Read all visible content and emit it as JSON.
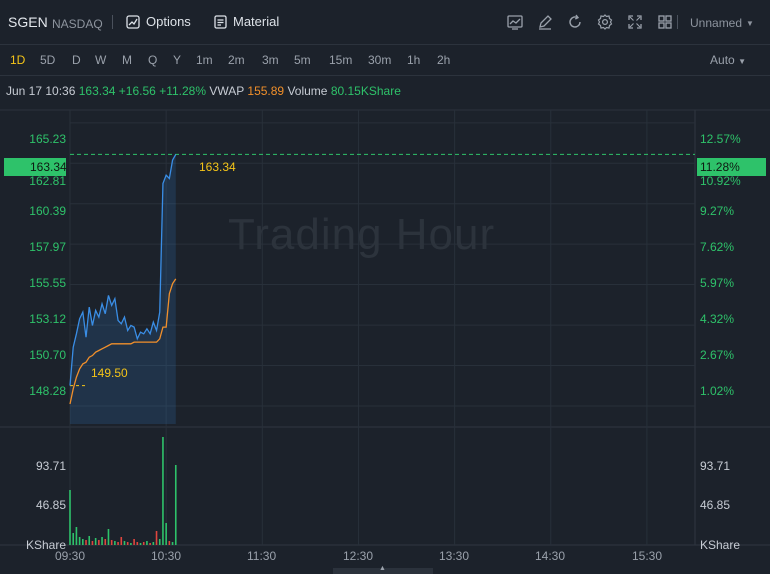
{
  "header": {
    "ticker": "SGEN",
    "exchange": "NASDAQ",
    "options_label": "Options",
    "material_label": "Material",
    "layout_name": "Unnamed",
    "tool_icons": [
      "chart-icon",
      "edit-icon",
      "refresh-icon",
      "settings-icon",
      "fullscreen-icon",
      "grid-icon"
    ]
  },
  "timeframes": [
    "1D",
    "5D",
    "D",
    "W",
    "M",
    "Q",
    "Y",
    "1m",
    "2m",
    "3m",
    "5m",
    "15m",
    "30m",
    "1h",
    "2h"
  ],
  "active_timeframe": "1D",
  "auto_label": "Auto",
  "info": {
    "datetime": "Jun 17 10:36",
    "price": "163.34",
    "change": "+16.56",
    "change_pct": "+11.28%",
    "vwap_label": "VWAP",
    "vwap_value": "155.89",
    "volume_label": "Volume",
    "volume_value": "80.15KShare"
  },
  "watermark": "Trading Hour",
  "price_axis": [
    "165.23",
    "162.81",
    "160.39",
    "157.97",
    "155.55",
    "153.12",
    "150.70",
    "148.28"
  ],
  "pct_axis": [
    "12.57%",
    "10.92%",
    "9.27%",
    "7.62%",
    "5.97%",
    "4.32%",
    "2.67%",
    "1.02%"
  ],
  "current_price_badge": "163.34",
  "current_pct_badge": "11.28%",
  "line_label_current": "163.34",
  "line_label_prevclose": "149.50",
  "volume_axis": [
    "93.71",
    "46.85"
  ],
  "volume_unit": "KShare",
  "time_axis": [
    "09:30",
    "10:30",
    "11:30",
    "12:30",
    "13:30",
    "14:30",
    "15:30"
  ],
  "colors": {
    "up": "#2ec26a",
    "down": "#e0463e",
    "price_line": "#3a8ee6",
    "vwap_line": "#f2902b",
    "accent": "#f5c518"
  },
  "chart_data": {
    "type": "line",
    "series": [
      {
        "name": "",
        "x": [
          "09:30",
          "09:32",
          "09:34",
          "09:36",
          "09:38",
          "09:40",
          "09:42",
          "09:44",
          "09:46",
          "09:48",
          "09:50",
          "09:52",
          "09:54",
          "09:56",
          "09:58",
          "10:00",
          "10:02",
          "10:04",
          "10:06",
          "10:08",
          "10:10",
          "10:12",
          "10:14",
          "10:16",
          "10:18",
          "10:20",
          "10:22",
          "10:24",
          "10:26",
          "10:28",
          "10:30",
          "10:32",
          "10:34",
          "10:36"
        ],
        "values": [
          149.5,
          151.8,
          152.6,
          153.5,
          153.9,
          152.4,
          154.2,
          153.1,
          154.0,
          153.6,
          154.4,
          153.8,
          154.9,
          154.3,
          154.7,
          153.4,
          153.2,
          153.6,
          152.8,
          153.1,
          153.0,
          152.3,
          152.7,
          152.6,
          152.9,
          152.6,
          153.3,
          152.8,
          153.9,
          161.6,
          162.1,
          161.9,
          163.0,
          163.34
        ]
      },
      {
        "name": "VWAP",
        "x": [
          "09:30",
          "09:32",
          "09:34",
          "09:36",
          "09:38",
          "09:40",
          "09:42",
          "09:44",
          "09:46",
          "09:48",
          "09:50",
          "09:52",
          "09:54",
          "09:56",
          "09:58",
          "10:00",
          "10:02",
          "10:04",
          "10:06",
          "10:08",
          "10:10",
          "10:12",
          "10:14",
          "10:16",
          "10:18",
          "10:20",
          "10:22",
          "10:24",
          "10:26",
          "10:28",
          "10:30",
          "10:32",
          "10:34",
          "10:36"
        ],
        "values": [
          148.4,
          149.3,
          150.0,
          150.5,
          150.8,
          150.9,
          151.2,
          151.3,
          151.5,
          151.6,
          151.7,
          151.8,
          151.9,
          152.0,
          152.0,
          152.0,
          152.0,
          152.0,
          152.0,
          152.0,
          152.1,
          152.1,
          152.1,
          152.1,
          152.1,
          152.1,
          152.1,
          152.1,
          152.3,
          153.0,
          153.0,
          155.0,
          155.6,
          155.89
        ]
      }
    ],
    "volume": [
      55,
      12,
      18,
      8,
      6,
      5,
      9,
      4,
      7,
      5,
      8,
      6,
      16,
      5,
      4,
      3,
      8,
      4,
      3,
      2,
      6,
      3,
      2,
      3,
      4,
      2,
      3,
      14,
      6,
      108,
      22,
      4,
      3,
      80
    ],
    "ylim": [
      147.2,
      166.0
    ],
    "xlim": [
      "09:30",
      "16:00"
    ]
  }
}
